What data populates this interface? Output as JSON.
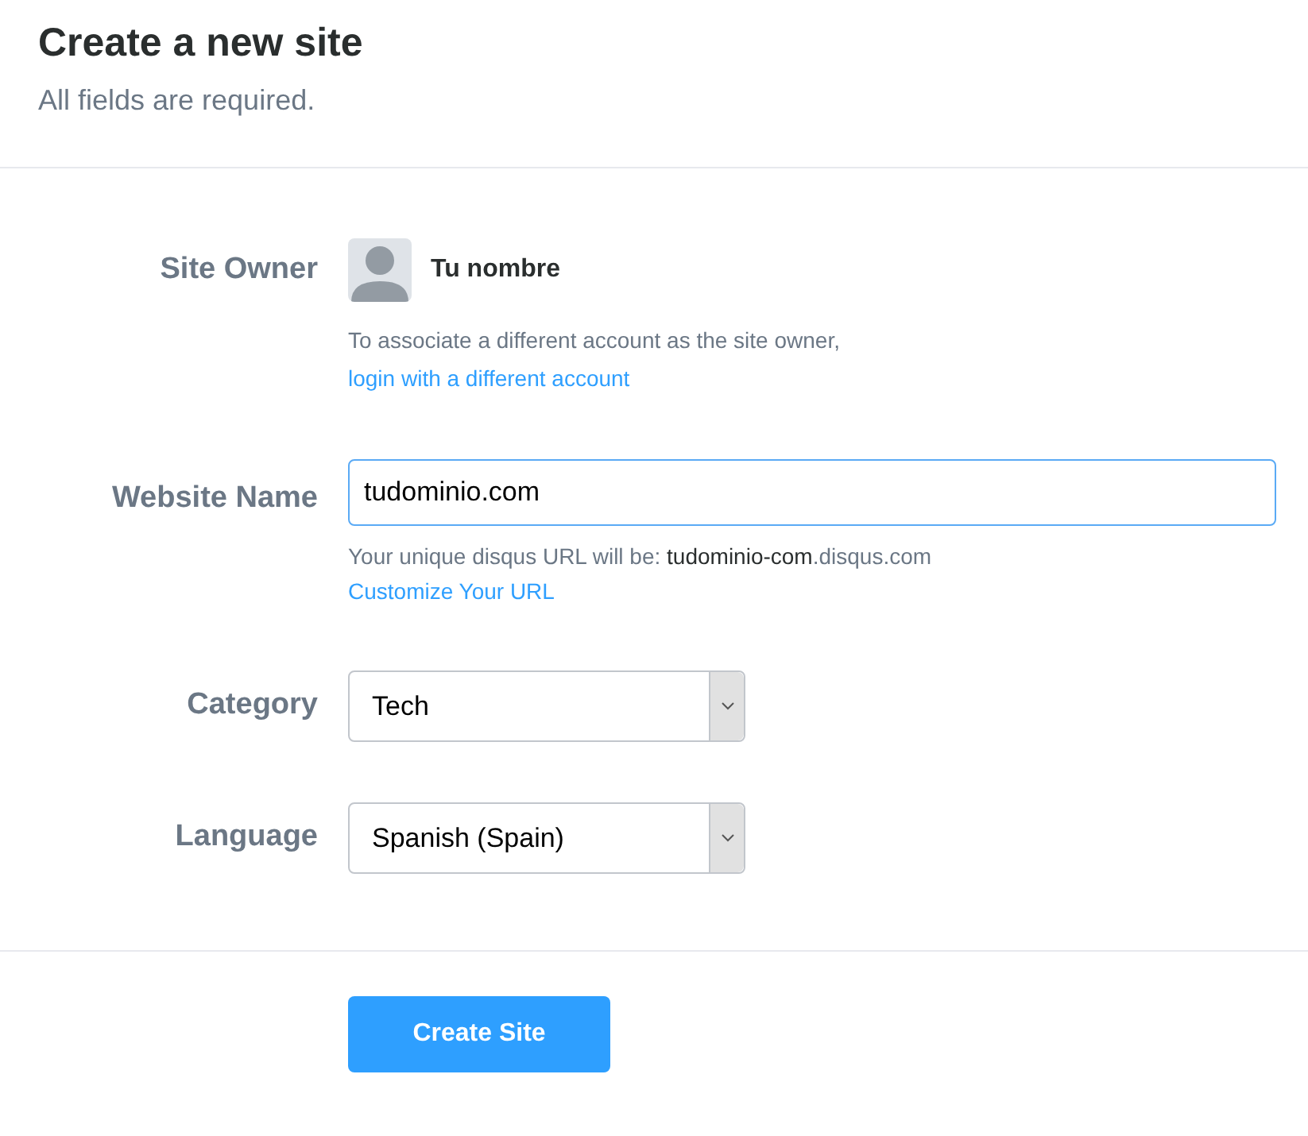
{
  "header": {
    "title": "Create a new site",
    "subtitle": "All fields are required."
  },
  "site_owner": {
    "label": "Site Owner",
    "name": "Tu nombre",
    "note": "To associate a different account as the site owner,",
    "link": "login with a different account"
  },
  "website_name": {
    "label": "Website Name",
    "value": "tudominio.com",
    "focused": true,
    "hint": "Your unique disqus URL will be: **tudominio-com**.disqus.com",
    "link": "Customize Your URL"
  },
  "selects": [
    {
      "label": "Category",
      "value": "Tech"
    },
    {
      "label": "Language",
      "value": "Spanish (Spain)"
    }
  ],
  "submit": {
    "label": "Create Site"
  }
}
